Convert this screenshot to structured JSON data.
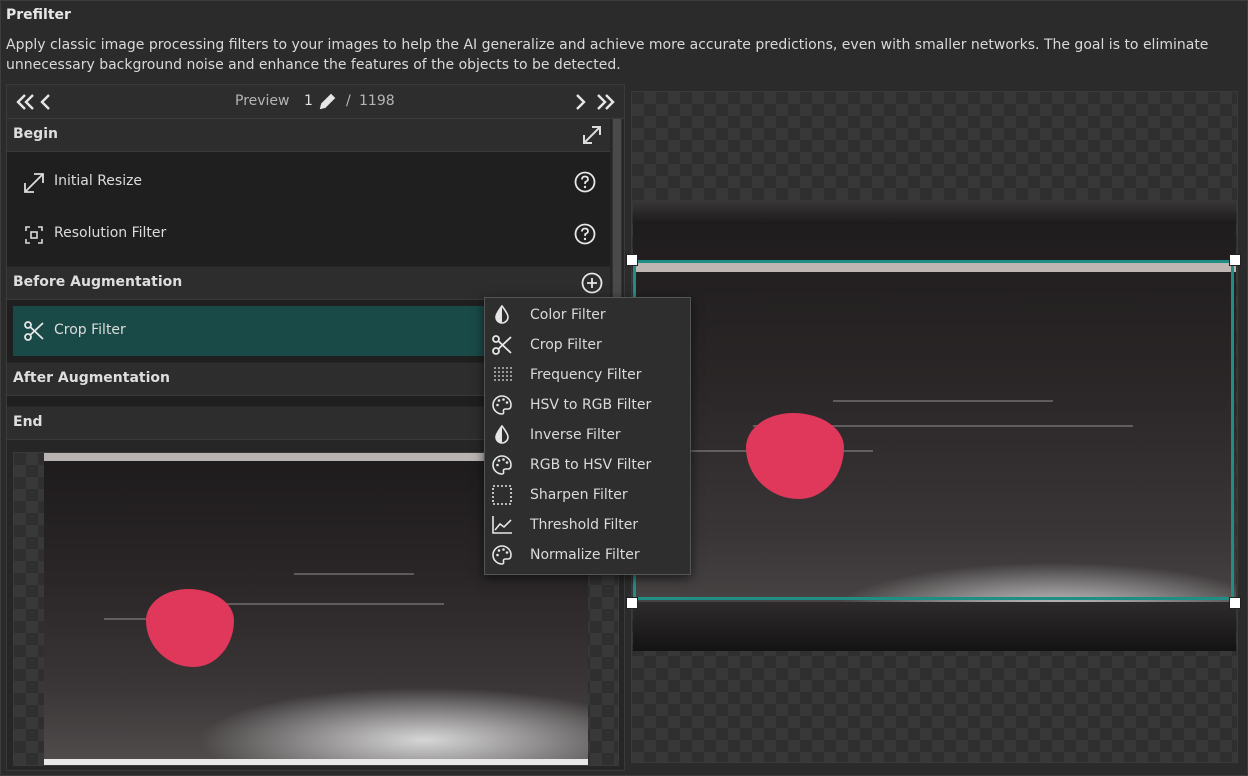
{
  "header": {
    "title": "Prefilter",
    "description": "Apply classic image processing filters to your images to help the AI generalize and achieve more accurate predictions, even with smaller networks. The goal is to eliminate unnecessary background noise and enhance the features of the objects to be detected."
  },
  "nav": {
    "preview_label": "Preview",
    "current_page": "1",
    "separator": "/",
    "total_pages": "1198"
  },
  "sections": {
    "begin": {
      "label": "Begin",
      "items": [
        {
          "label": "Initial Resize",
          "icon": "resize-icon"
        },
        {
          "label": "Resolution Filter",
          "icon": "resolution-icon"
        }
      ]
    },
    "before_augmentation": {
      "label": "Before Augmentation",
      "items": [
        {
          "label": "Crop Filter",
          "icon": "scissors-icon",
          "selected": true
        }
      ]
    },
    "after_augmentation": {
      "label": "After Augmentation"
    },
    "end": {
      "label": "End"
    }
  },
  "menu": {
    "items": [
      {
        "label": "Color Filter",
        "icon": "drop-icon"
      },
      {
        "label": "Crop Filter",
        "icon": "scissors-icon"
      },
      {
        "label": "Frequency Filter",
        "icon": "grid-dots-icon"
      },
      {
        "label": "HSV to RGB Filter",
        "icon": "palette-icon"
      },
      {
        "label": "Inverse Filter",
        "icon": "drop-icon"
      },
      {
        "label": "RGB to HSV Filter",
        "icon": "palette-icon"
      },
      {
        "label": "Sharpen Filter",
        "icon": "dashed-square-icon"
      },
      {
        "label": "Threshold Filter",
        "icon": "line-chart-icon"
      },
      {
        "label": "Normalize Filter",
        "icon": "palette-icon"
      }
    ]
  },
  "colors": {
    "selected_row": "#1a4a47",
    "crop_box": "#1f8f86",
    "object": "#e0385a"
  }
}
